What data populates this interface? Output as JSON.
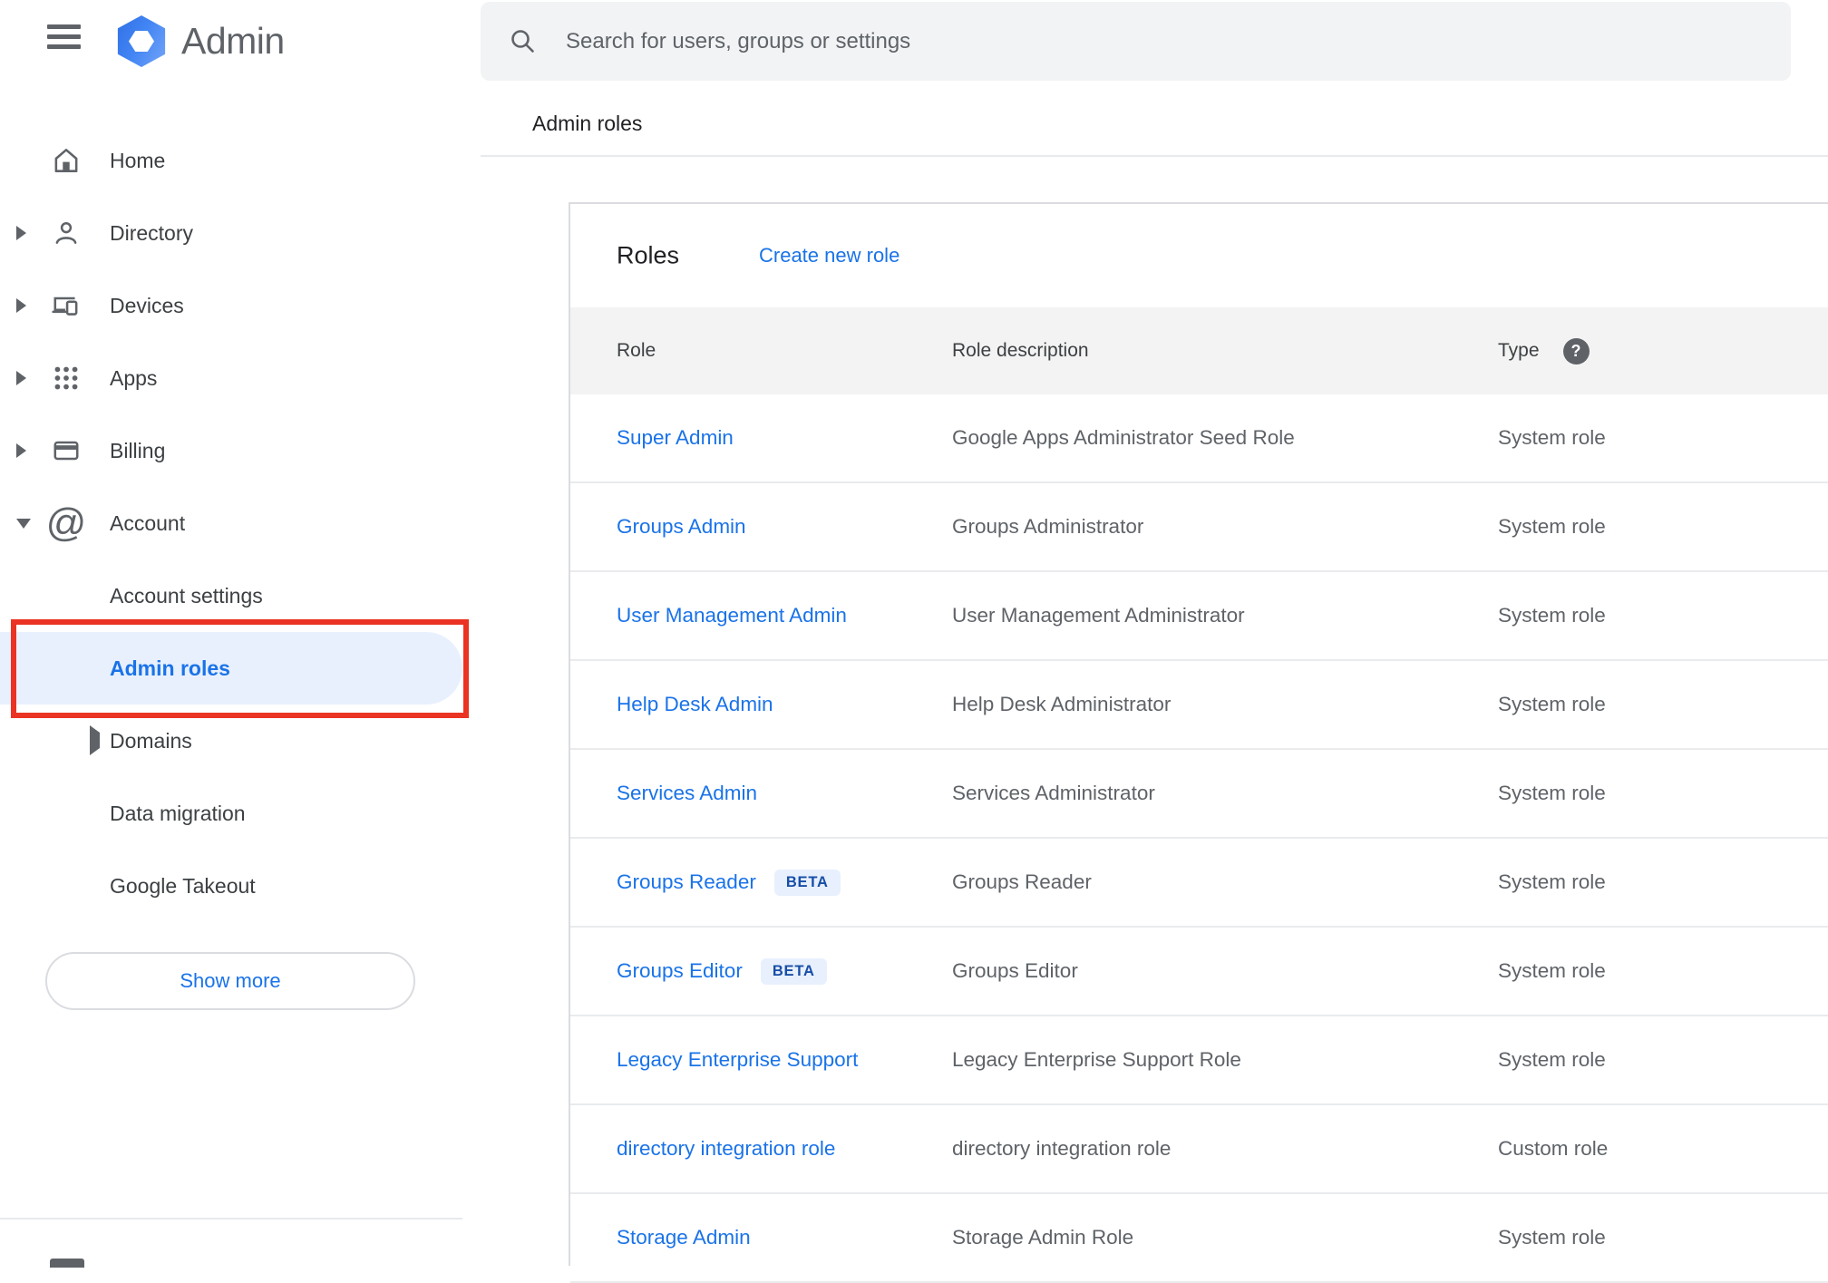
{
  "app": {
    "name": "Admin"
  },
  "topbar": {
    "search_placeholder": "Search for users, groups or settings"
  },
  "breadcrumb": "Admin roles",
  "sidebar": {
    "items": [
      {
        "label": "Home"
      },
      {
        "label": "Directory"
      },
      {
        "label": "Devices"
      },
      {
        "label": "Apps"
      },
      {
        "label": "Billing"
      },
      {
        "label": "Account"
      }
    ],
    "account_children": [
      {
        "label": "Account settings"
      },
      {
        "label": "Admin roles",
        "selected": true,
        "annotated": true
      },
      {
        "label": "Domains"
      },
      {
        "label": "Data migration"
      },
      {
        "label": "Google Takeout"
      }
    ],
    "show_more": "Show more"
  },
  "roles_card": {
    "title": "Roles",
    "create_link": "Create new role",
    "columns": {
      "role": "Role",
      "description": "Role description",
      "type": "Type"
    },
    "rows": [
      {
        "role": "Super Admin",
        "description": "Google Apps Administrator Seed Role",
        "type": "System role"
      },
      {
        "role": "Groups Admin",
        "description": "Groups Administrator",
        "type": "System role"
      },
      {
        "role": "User Management Admin",
        "description": "User Management Administrator",
        "type": "System role"
      },
      {
        "role": "Help Desk Admin",
        "description": "Help Desk Administrator",
        "type": "System role"
      },
      {
        "role": "Services Admin",
        "description": "Services Administrator",
        "type": "System role"
      },
      {
        "role": "Groups Reader",
        "badge": "BETA",
        "description": "Groups Reader",
        "type": "System role"
      },
      {
        "role": "Groups Editor",
        "badge": "BETA",
        "description": "Groups Editor",
        "type": "System role"
      },
      {
        "role": "Legacy Enterprise Support",
        "description": "Legacy Enterprise Support Role",
        "type": "System role"
      },
      {
        "role": "directory integration role",
        "description": "directory integration role",
        "type": "Custom role"
      },
      {
        "role": "Storage Admin",
        "description": "Storage Admin Role",
        "type": "System role"
      }
    ]
  },
  "icons": {
    "hamburger": "menu",
    "logo": "blue-hexagon",
    "search": "magnifier",
    "home": "house",
    "directory": "person",
    "devices": "laptop-and-phone",
    "apps": "grid-3x3-dots",
    "billing": "credit-card",
    "account": "at-sign",
    "type_help": "question-mark-circle",
    "expand": "triangle-right",
    "collapse": "triangle-down"
  },
  "colors": {
    "accent_blue": "#1a73e8",
    "selected_item_bg": "#e8f0fe",
    "beta_badge_bg": "#e8f0fe",
    "beta_badge_text": "#174ea6",
    "annotation_red": "#ea3323",
    "header_row_bg": "#f3f3f3",
    "text_primary": "#202124",
    "text_secondary": "#5f6368"
  }
}
